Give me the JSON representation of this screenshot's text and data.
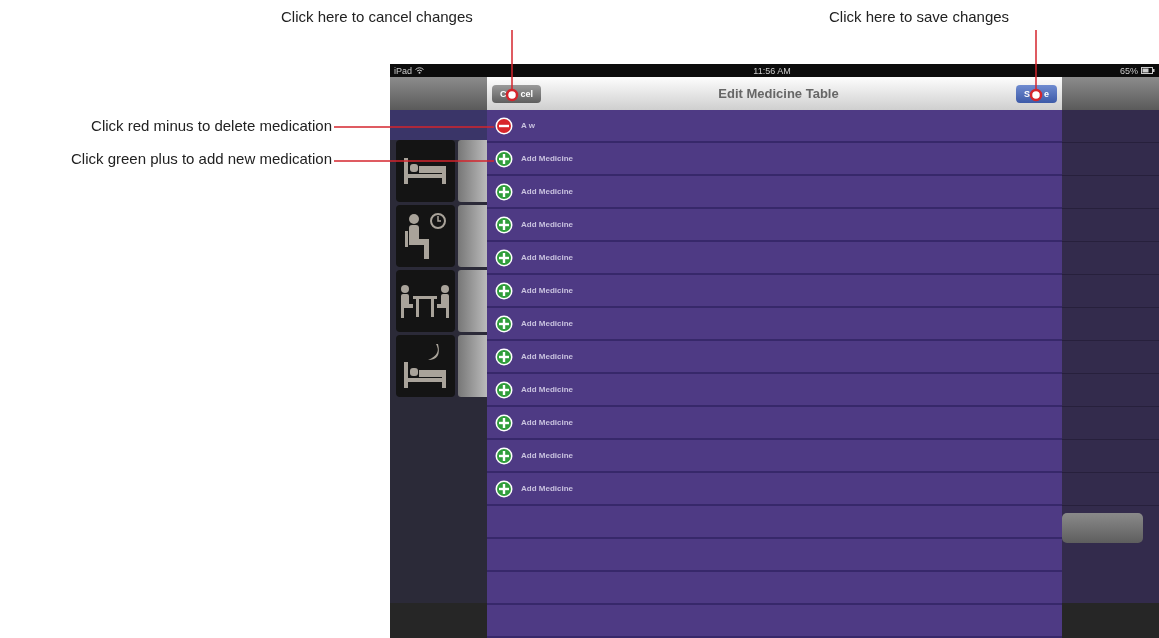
{
  "callouts": [
    {
      "kind": "top",
      "text": "Click here to cancel changes"
    },
    {
      "kind": "top",
      "text": "Click here to save changes"
    },
    {
      "kind": "left",
      "text": "Click red minus to delete medication"
    },
    {
      "kind": "left",
      "text": "Click green plus to add new medication"
    }
  ],
  "status_bar": {
    "device": "iPad",
    "time": "11:56 AM",
    "battery": "65%"
  },
  "modal": {
    "title": "Edit Medicine Table",
    "cancel": [
      "C",
      "cel"
    ],
    "save": [
      "S",
      "e"
    ],
    "rows": [
      {
        "kind": "delete",
        "label": "A w"
      },
      {
        "kind": "add",
        "label": "Add Medicine"
      },
      {
        "kind": "add",
        "label": "Add Medicine"
      },
      {
        "kind": "add",
        "label": "Add Medicine"
      },
      {
        "kind": "add",
        "label": "Add Medicine"
      },
      {
        "kind": "add",
        "label": "Add Medicine"
      },
      {
        "kind": "add",
        "label": "Add Medicine"
      },
      {
        "kind": "add",
        "label": "Add Medicine"
      },
      {
        "kind": "add",
        "label": "Add Medicine"
      },
      {
        "kind": "add",
        "label": "Add Medicine"
      },
      {
        "kind": "add",
        "label": "Add Medicine"
      },
      {
        "kind": "add",
        "label": "Add Medicine"
      },
      {
        "kind": "empty"
      },
      {
        "kind": "empty"
      },
      {
        "kind": "empty"
      },
      {
        "kind": "empty"
      }
    ]
  }
}
